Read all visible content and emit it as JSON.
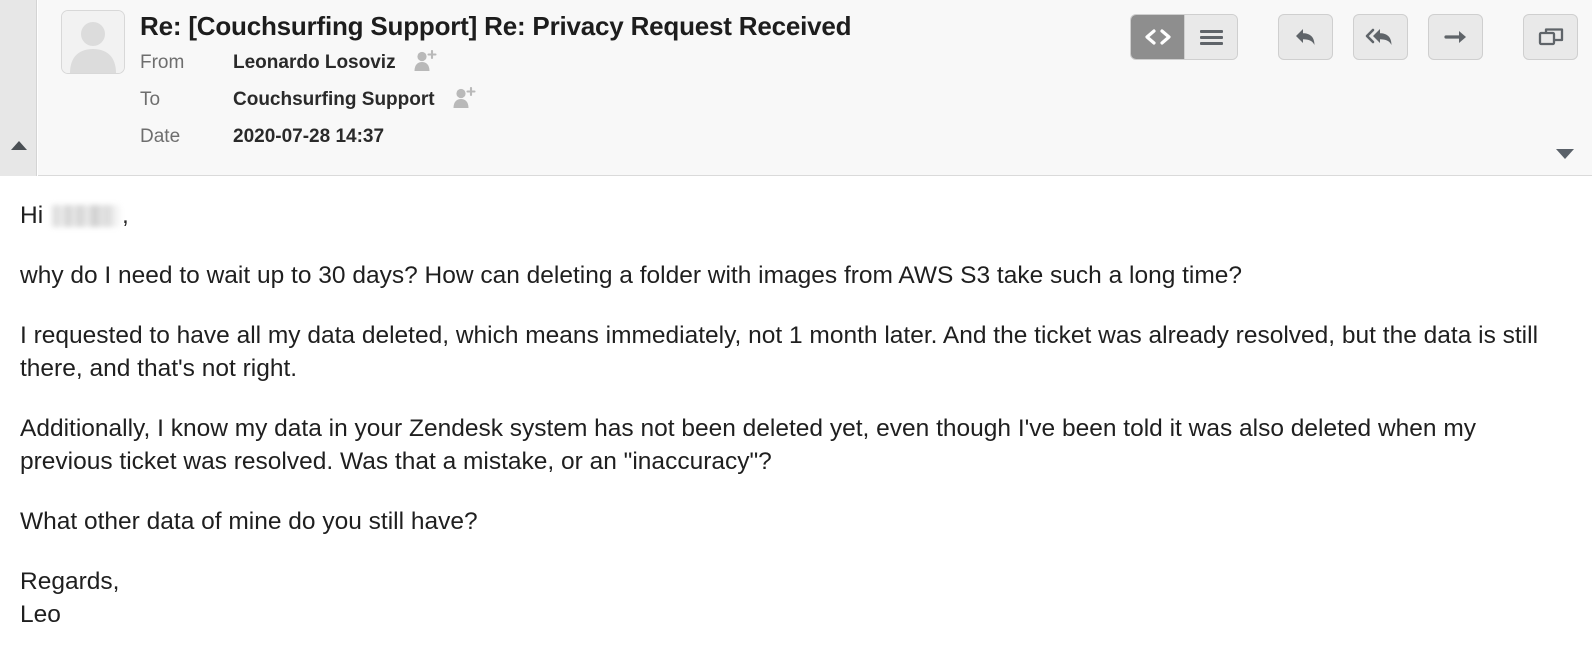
{
  "header": {
    "subject": "Re: [Couchsurfing Support] Re: Privacy Request Received",
    "fields": [
      {
        "label": "From",
        "value": "Leonardo Losoviz",
        "has_add_contact": true
      },
      {
        "label": "To",
        "value": "Couchsurfing Support",
        "has_add_contact": true
      },
      {
        "label": "Date",
        "value": "2020-07-28 14:37",
        "has_add_contact": false
      }
    ]
  },
  "toolbar": {
    "view_source_label": "",
    "view_plain_label": "",
    "reply_label": "",
    "reply_all_label": "",
    "forward_label": "",
    "open_window_label": ""
  },
  "gutter": {
    "collapse_label": ""
  },
  "body": {
    "greeting_prefix": "Hi ",
    "greeting_suffix": ",",
    "paragraphs": [
      "why do I need to wait up to 30 days? How can deleting a folder with images from AWS S3 take such a long time?",
      "I requested to have all my data deleted, which means immediately, not 1 month later. And the ticket was already resolved, but the data is still there, and that's not right.",
      "Additionally, I know my data in your Zendesk system has not been deleted yet, even though I've been told it was also deleted when my previous ticket was resolved. Was that a mistake, or an \"inaccuracy\"?",
      "What other data of mine do you still have?"
    ],
    "signoff": "Regards,",
    "signature_name": "Leo"
  }
}
